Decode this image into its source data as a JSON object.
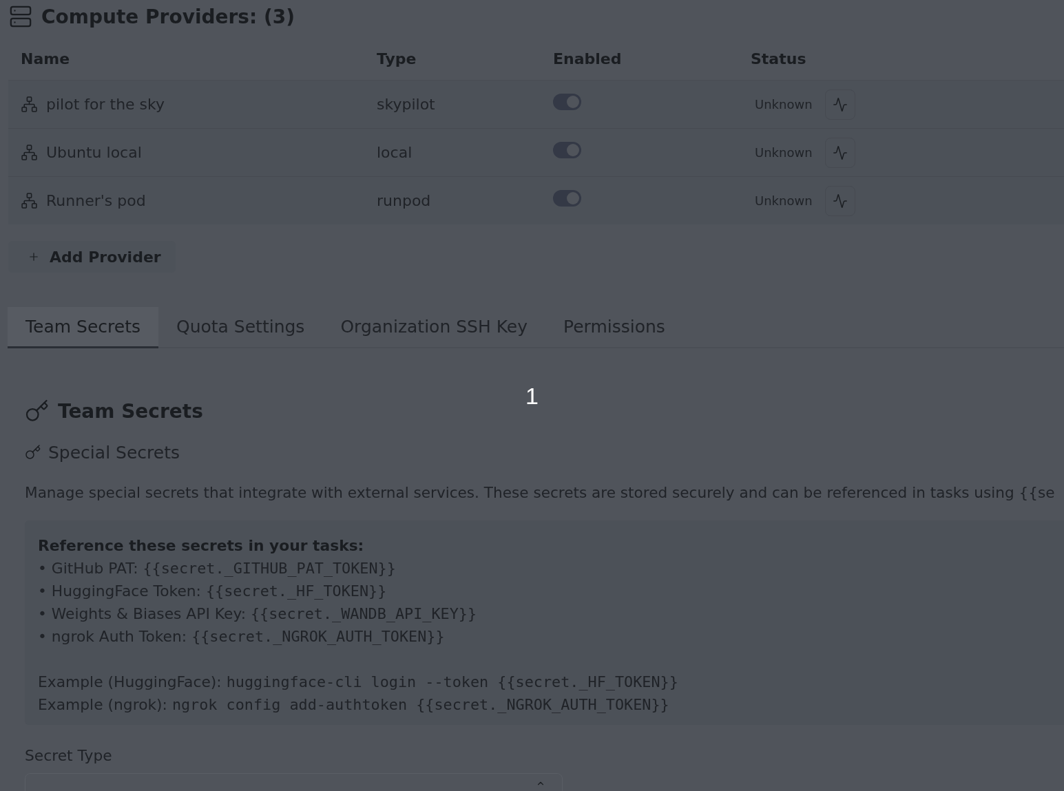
{
  "providers": {
    "title": "Compute Providers: (3)",
    "columns": [
      "Name",
      "Type",
      "Enabled",
      "Status"
    ],
    "rows": [
      {
        "name": "pilot for the sky",
        "type": "skypilot",
        "enabled": true,
        "status": "Unknown"
      },
      {
        "name": "Ubuntu local",
        "type": "local",
        "enabled": true,
        "status": "Unknown"
      },
      {
        "name": "Runner's pod",
        "type": "runpod",
        "enabled": true,
        "status": "Unknown"
      }
    ],
    "add_button": "Add Provider"
  },
  "tabs": [
    {
      "label": "Team Secrets",
      "selected": true
    },
    {
      "label": "Quota Settings",
      "selected": false
    },
    {
      "label": "Organization SSH Key",
      "selected": false
    },
    {
      "label": "Permissions",
      "selected": false
    }
  ],
  "marker": "1",
  "team_secrets": {
    "title": "Team Secrets",
    "subtitle": "Special Secrets",
    "description": "Manage special secrets that integrate with external services. These secrets are stored securely and can be referenced in tasks using {{se",
    "reference": {
      "title": "Reference these secrets in your tasks:",
      "items": [
        {
          "label": "• GitHub PAT:",
          "code": "{{secret._GITHUB_PAT_TOKEN}}"
        },
        {
          "label": "• HuggingFace Token:",
          "code": "{{secret._HF_TOKEN}}"
        },
        {
          "label": "• Weights & Biases API Key:",
          "code": "{{secret._WANDB_API_KEY}}"
        },
        {
          "label": "• ngrok Auth Token:",
          "code": "{{secret._NGROK_AUTH_TOKEN}}"
        }
      ],
      "examples": [
        {
          "label": "Example (HuggingFace):",
          "code": "huggingface-cli login --token {{secret._HF_TOKEN}}"
        },
        {
          "label": "Example (ngrok):",
          "code": "ngrok config add-authtoken {{secret._NGROK_AUTH_TOKEN}}"
        }
      ]
    },
    "secret_type": {
      "label": "Secret Type"
    }
  }
}
